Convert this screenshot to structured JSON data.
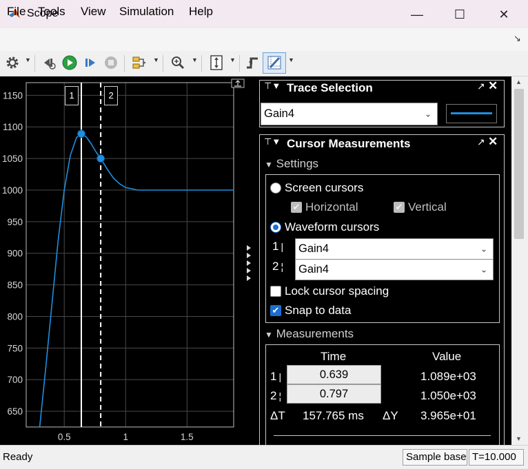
{
  "window": {
    "title": "Scope",
    "minimize_glyph": "—",
    "maximize_glyph": "☐",
    "close_glyph": "✕"
  },
  "menu": {
    "items": [
      "File",
      "Tools",
      "View",
      "Simulation",
      "Help"
    ]
  },
  "toolbar": {
    "buttons": [
      "settings-icon",
      "step-back-icon",
      "run-icon",
      "step-forward-icon",
      "stop-icon",
      "signal-selection-icon",
      "zoom-icon",
      "scale-y-axis-icon",
      "triggers-icon",
      "cursor-measurements-icon"
    ]
  },
  "plot": {
    "y_ticks": [
      "1150",
      "1100",
      "1050",
      "1000",
      "950",
      "900",
      "850",
      "800",
      "750",
      "700",
      "650"
    ],
    "x_ticks": [
      "0.5",
      "1",
      "1.5"
    ],
    "cursor1_flag": "1",
    "cursor2_flag": "2",
    "colors": {
      "trace": "#1f8fdf",
      "grid": "#4a4a4a",
      "cursor": "#ffffff"
    }
  },
  "chart_data": {
    "type": "line",
    "title": "",
    "xlabel": "",
    "ylabel": "",
    "xlim": [
      0.19,
      1.88
    ],
    "ylim": [
      625,
      1170
    ],
    "grid": true,
    "series": [
      {
        "x": [
          0.3,
          0.35,
          0.4,
          0.45,
          0.5,
          0.55,
          0.6,
          0.639,
          0.68,
          0.72,
          0.76,
          0.797,
          0.85,
          0.9,
          0.95,
          1.0,
          1.05,
          1.1,
          1.2,
          1.3,
          1.5,
          1.7,
          1.88
        ],
        "y": [
          625,
          720,
          820,
          920,
          1000,
          1055,
          1083,
          1089,
          1084,
          1073,
          1060,
          1050,
          1033,
          1019,
          1010,
          1004,
          1002,
          1000,
          1000,
          1000,
          1000,
          1000,
          1000
        ]
      }
    ],
    "cursors": [
      {
        "label": "1",
        "x": 0.639,
        "y": 1089,
        "style": "solid"
      },
      {
        "label": "2",
        "x": 0.797,
        "y": 1050,
        "style": "dashed"
      }
    ]
  },
  "trace_selection": {
    "title": "Trace Selection",
    "selected": "Gain4",
    "line_color": "#1f8fdf"
  },
  "cursor_measurements": {
    "title": "Cursor Measurements",
    "settings": {
      "label": "Settings",
      "screen_cursors": "Screen cursors",
      "horizontal": "Horizontal",
      "vertical": "Vertical",
      "waveform_cursors": "Waveform cursors",
      "cursor1_num": "1",
      "cursor2_num": "2",
      "cursor1_signal": "Gain4",
      "cursor2_signal": "Gain4",
      "lock_spacing": "Lock cursor spacing",
      "snap_to_data": "Snap to data"
    },
    "measurements": {
      "label": "Measurements",
      "time_header": "Time",
      "value_header": "Value",
      "row1_num": "1",
      "row2_num": "2",
      "time1": "0.639",
      "time2": "0.797",
      "value1": "1.089e+03",
      "value2": "1.050e+03",
      "delta_t_label": "ΔT",
      "delta_t_value": "157.765 ms",
      "delta_y_label": "ΔY",
      "delta_y_value": "3.965e+01"
    }
  },
  "status": {
    "left": "Ready",
    "mode": "Sample based",
    "time": "T=10.000"
  }
}
